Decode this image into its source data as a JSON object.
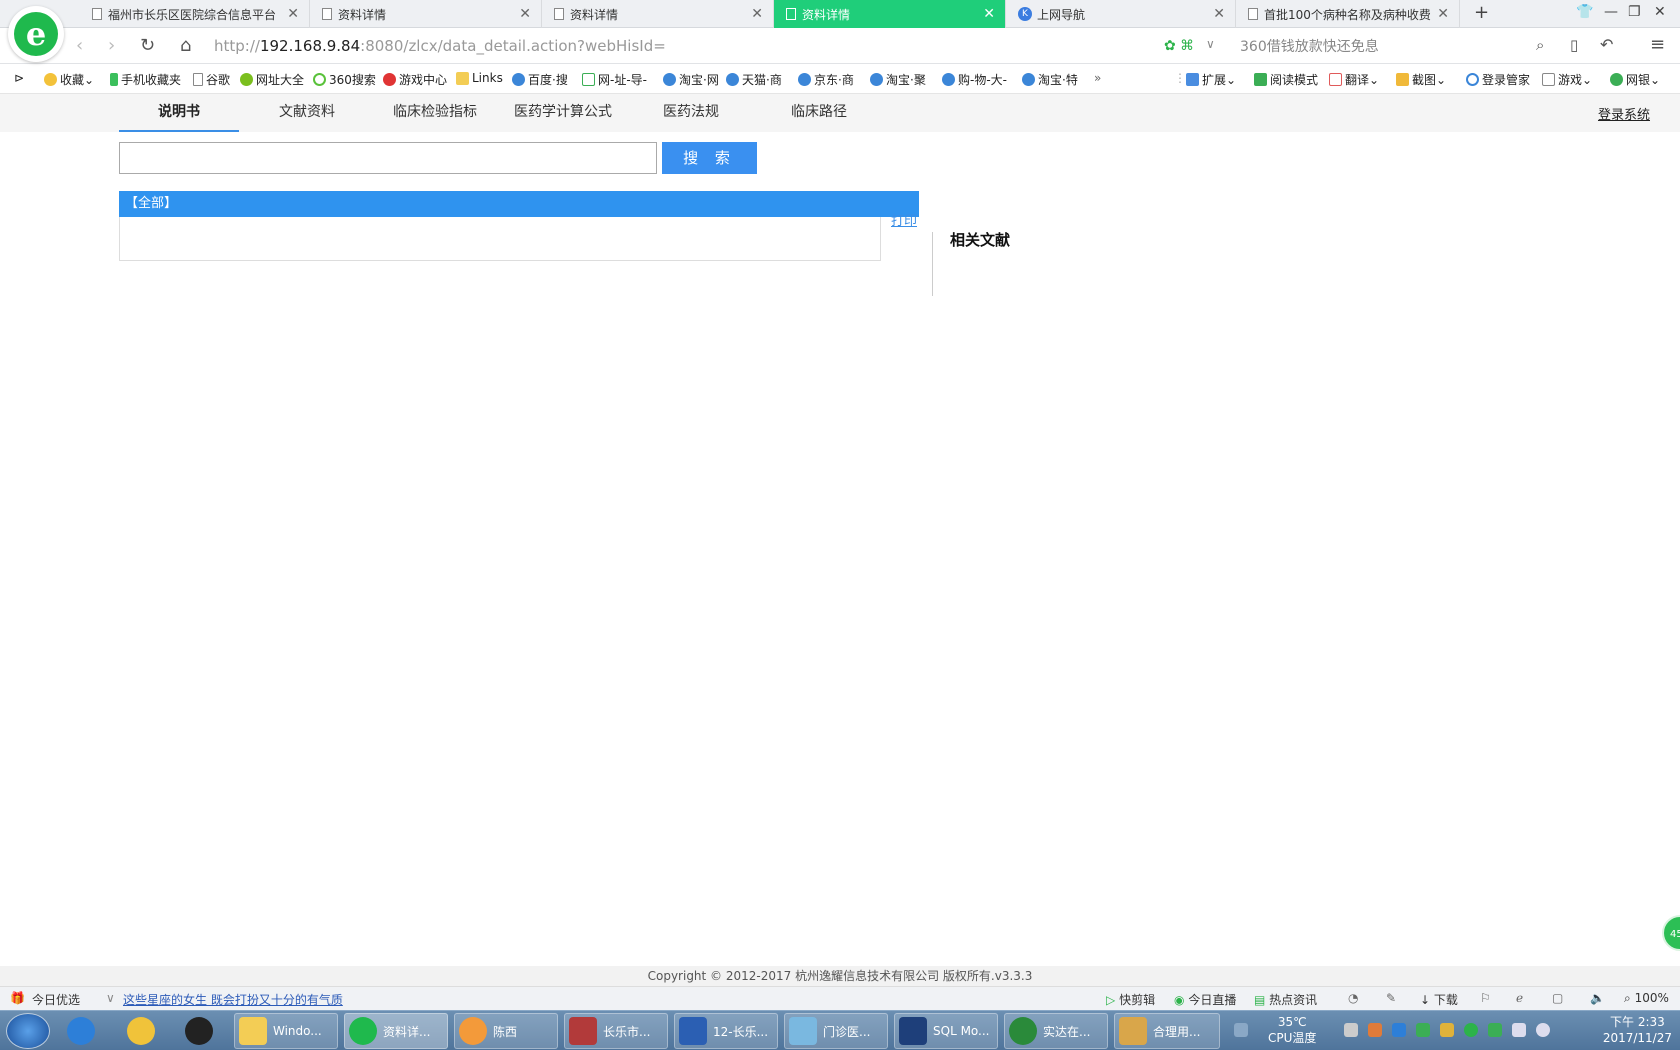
{
  "browser": {
    "tabs": [
      {
        "label": "福州市长乐区医院综合信息平台",
        "active": false
      },
      {
        "label": "资料详情",
        "active": false
      },
      {
        "label": "资料详情",
        "active": false
      },
      {
        "label": "资料详情",
        "active": true
      },
      {
        "label": "上网导航",
        "active": false
      },
      {
        "label": "首批100个病种名称及病种收费",
        "active": false
      }
    ],
    "new_tab_label": "+",
    "url_prefix": "http://",
    "url_host": "192.168.9.84",
    "url_rest": ":8080/zlcx/data_detail.action?webHisId=",
    "search_hint": "360借钱放款快还免息",
    "bookmarks": [
      "收藏",
      "手机收藏夹",
      "谷歌",
      "网址大全",
      "360搜索",
      "游戏中心",
      "Links",
      "百度·搜",
      "网-址-导-",
      "淘宝·网",
      "天猫·商",
      "京东·商",
      "淘宝·聚",
      "购-物-大-",
      "淘宝·特"
    ],
    "toolbar_right": [
      "扩展",
      "阅读模式",
      "翻译",
      "截图",
      "登录管家",
      "游戏",
      "网银"
    ]
  },
  "page": {
    "nav": [
      "说明书",
      "文献资料",
      "临床检验指标",
      "医药学计算公式",
      "医药法规",
      "临床路径"
    ],
    "login": "登录系统",
    "search_placeholder": "",
    "search_button": "搜 索",
    "all_label": "【全部】",
    "print": "打印",
    "related": "相关文献",
    "copyright": "Copyright © 2012-2017 杭州逸耀信息技术有限公司  版权所有.v3.3.3",
    "badge": "45"
  },
  "statusbar": {
    "left1": "今日优选",
    "left2": "这些星座的女生 既会打扮又十分的有气质",
    "right": [
      "快剪辑",
      "今日直播",
      "热点资讯",
      "下载",
      "100%"
    ]
  },
  "taskbar": {
    "items": [
      "Windo...",
      "资料详...",
      "陈西",
      "长乐市...",
      "12-长乐...",
      "门诊医...",
      "SQL Mo...",
      "实达在...",
      "合理用..."
    ],
    "temp_value": "35℃",
    "temp_label": "CPU温度",
    "time": "下午 2:33",
    "date": "2017/11/27"
  },
  "colors": {
    "accent": "#2f93ef",
    "active_tab": "#1fce7a"
  }
}
